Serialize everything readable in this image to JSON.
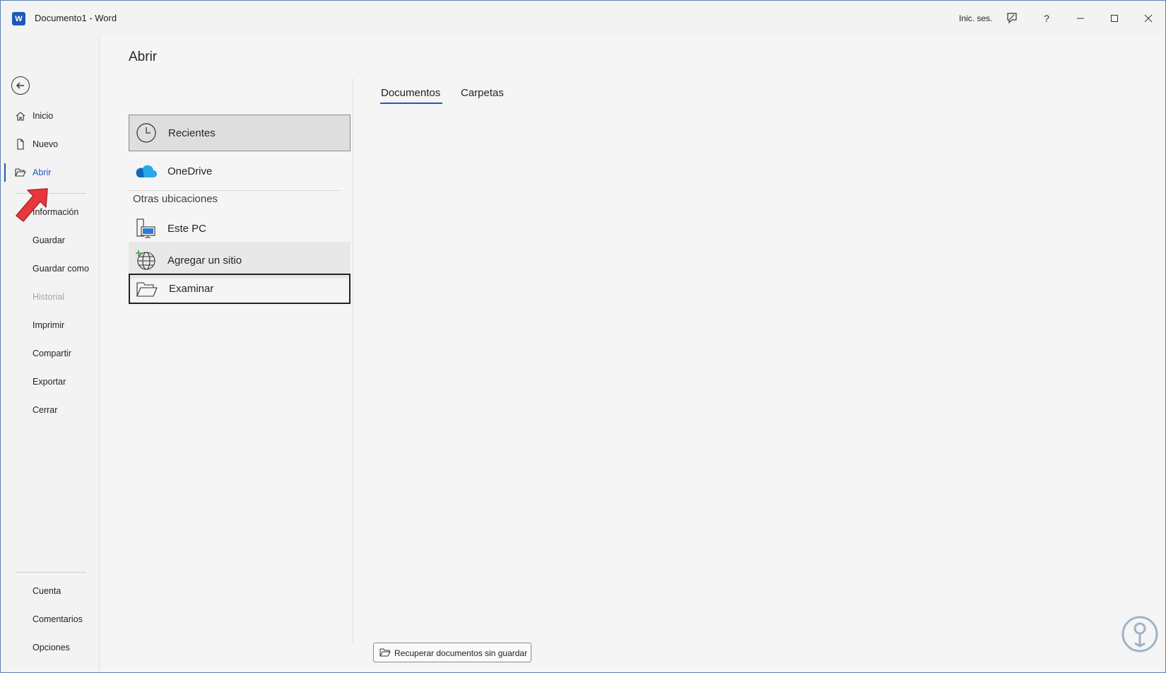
{
  "window": {
    "title": "Documento1  -  Word",
    "app_icon_letter": "W",
    "signin_label": "Inic. ses.",
    "controls": [
      "comments-icon",
      "help-icon",
      "minimize-icon",
      "maximize-icon",
      "close-icon"
    ],
    "help_glyph": "?"
  },
  "nav": {
    "items_top": [
      {
        "label": "Inicio",
        "icon": "home-icon"
      },
      {
        "label": "Nuevo",
        "icon": "new-document-icon"
      },
      {
        "label": "Abrir",
        "icon": "open-folder-icon"
      }
    ],
    "items_mid": [
      {
        "label": "Información"
      },
      {
        "label": "Guardar"
      },
      {
        "label": "Guardar como"
      },
      {
        "label": "Historial"
      },
      {
        "label": "Imprimir"
      },
      {
        "label": "Compartir"
      },
      {
        "label": "Exportar"
      },
      {
        "label": "Cerrar"
      }
    ],
    "items_bottom": [
      {
        "label": "Cuenta"
      },
      {
        "label": "Comentarios"
      },
      {
        "label": "Opciones"
      }
    ]
  },
  "main": {
    "title": "Abrir",
    "locations": {
      "recientes": "Recientes",
      "onedrive": "OneDrive",
      "section_label": "Otras ubicaciones",
      "este_pc": "Este PC",
      "agregar": "Agregar un sitio",
      "examinar": "Examinar"
    },
    "tabs": [
      "Documentos",
      "Carpetas"
    ],
    "recover_button": "Recuperar documentos sin guardar"
  },
  "colors": {
    "accent": "#1e5bb8",
    "annotation_arrow": "#e8383d"
  }
}
